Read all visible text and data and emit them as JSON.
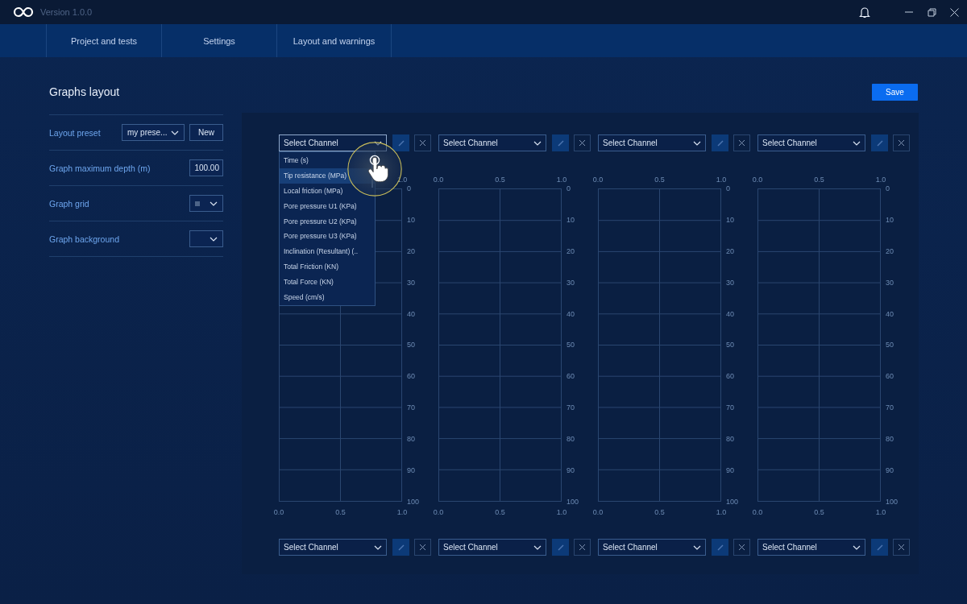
{
  "window": {
    "title": "Version 1.0.0"
  },
  "nav": {
    "tabs": [
      {
        "label": "Project and tests"
      },
      {
        "label": "Settings"
      },
      {
        "label": "Layout and warnings"
      }
    ]
  },
  "page": {
    "title": "Graphs layout",
    "save": "Save"
  },
  "settings": [
    {
      "kind": "preset",
      "label": "Layout preset",
      "value": "my prese...",
      "button": "New"
    },
    {
      "kind": "number",
      "label": "Graph maximum depth (m)",
      "value": "100.00"
    },
    {
      "kind": "swatch",
      "label": "Graph grid"
    },
    {
      "kind": "select",
      "label": "Graph background"
    }
  ],
  "graphs": [
    {
      "top_select": {
        "value": "Select Channel",
        "expanded": true,
        "options": [
          {
            "label": "Time (s)",
            "selected": false
          },
          {
            "label": "Tip resistance (MPa)",
            "selected": true
          },
          {
            "label": "Local friction (MPa)",
            "selected": false
          },
          {
            "label": "Pore pressure U1 (KPa)",
            "selected": false
          },
          {
            "label": "Pore pressure U2 (KPa)",
            "selected": false
          },
          {
            "label": "Pore pressure U3 (KPa)",
            "selected": false
          },
          {
            "label": "Inclination (Resultant) (..",
            "selected": false
          },
          {
            "label": "Total Friction (KN)",
            "selected": false
          },
          {
            "label": "Total Force (KN)",
            "selected": false
          },
          {
            "label": "Speed (cm/s)",
            "selected": false
          }
        ]
      },
      "top_ticks": [
        "1.0"
      ],
      "depth_ticks": [
        "0",
        "10",
        "20",
        "30",
        "40",
        "50",
        "60",
        "70",
        "80",
        "90",
        "100"
      ],
      "bottom_ticks": [
        "0.0",
        "0.5",
        "1.0"
      ],
      "bottom_select": {
        "value": "Select Channel",
        "expanded": false
      }
    },
    {
      "top_select": {
        "value": "Select Channel",
        "expanded": false
      },
      "top_ticks": [
        "0.0",
        "0.5",
        "1.0"
      ],
      "depth_ticks": [
        "0",
        "10",
        "20",
        "30",
        "40",
        "50",
        "60",
        "70",
        "80",
        "90",
        "100"
      ],
      "bottom_ticks": [
        "0.0",
        "0.5",
        "1.0"
      ],
      "bottom_select": {
        "value": "Select Channel",
        "expanded": false
      }
    },
    {
      "top_select": {
        "value": "Select Channel",
        "expanded": false
      },
      "top_ticks": [
        "0.0",
        "0.5",
        "1.0"
      ],
      "depth_ticks": [
        "0",
        "10",
        "20",
        "30",
        "40",
        "50",
        "60",
        "70",
        "80",
        "90",
        "100"
      ],
      "bottom_ticks": [
        "0.0",
        "0.5",
        "1.0"
      ],
      "bottom_select": {
        "value": "Select Channel",
        "expanded": false
      }
    },
    {
      "top_select": {
        "value": "Select Channel",
        "expanded": false
      },
      "top_ticks": [
        "0.0",
        "0.5",
        "1.0"
      ],
      "depth_ticks": [
        "0",
        "10",
        "20",
        "30",
        "40",
        "50",
        "60",
        "70",
        "80",
        "90",
        "100"
      ],
      "bottom_ticks": [
        "0.0",
        "0.5",
        "1.0"
      ],
      "bottom_select": {
        "value": "Select Channel",
        "expanded": false
      }
    }
  ]
}
